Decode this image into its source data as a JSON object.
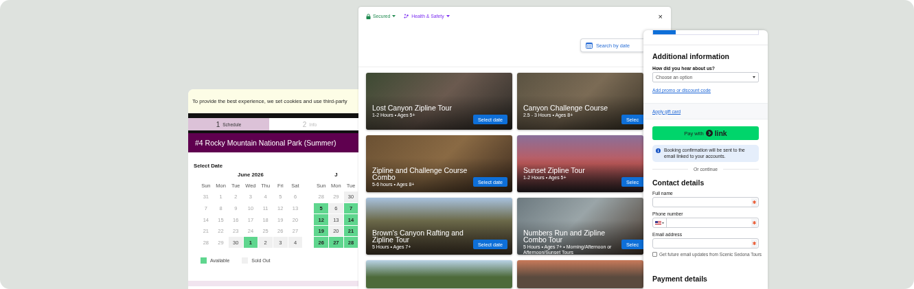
{
  "left_window": {
    "cookie_banner": "To provide the best experience, we set cookies and use third-party",
    "steps": [
      {
        "number": "1",
        "label": "Schedule",
        "selected": true
      },
      {
        "number": "2",
        "label": "Info",
        "selected": false
      }
    ],
    "title": "#4 Rocky Mountain National Park (Summer)",
    "select_date_label": "Select Date",
    "months": [
      {
        "title": "June 2026",
        "weekdays": [
          "Sun",
          "Mon",
          "Tue",
          "Wed",
          "Thu",
          "Fri",
          "Sat"
        ],
        "weeks": [
          [
            {
              "day": "31",
              "kind": "outside"
            },
            {
              "day": "1",
              "kind": "outside"
            },
            {
              "day": "2",
              "kind": "outside"
            },
            {
              "day": "3",
              "kind": "outside"
            },
            {
              "day": "4",
              "kind": "outside"
            },
            {
              "day": "5",
              "kind": "outside"
            },
            {
              "day": "6",
              "kind": "outside"
            }
          ],
          [
            {
              "day": "7",
              "kind": "outside"
            },
            {
              "day": "8",
              "kind": "outside"
            },
            {
              "day": "9",
              "kind": "outside"
            },
            {
              "day": "10",
              "kind": "outside"
            },
            {
              "day": "11",
              "kind": "outside"
            },
            {
              "day": "12",
              "kind": "outside"
            },
            {
              "day": "13",
              "kind": "outside"
            }
          ],
          [
            {
              "day": "14",
              "kind": "outside"
            },
            {
              "day": "15",
              "kind": "outside"
            },
            {
              "day": "16",
              "kind": "outside"
            },
            {
              "day": "17",
              "kind": "outside"
            },
            {
              "day": "18",
              "kind": "outside"
            },
            {
              "day": "19",
              "kind": "outside"
            },
            {
              "day": "20",
              "kind": "outside"
            }
          ],
          [
            {
              "day": "21",
              "kind": "outside"
            },
            {
              "day": "22",
              "kind": "outside"
            },
            {
              "day": "23",
              "kind": "outside"
            },
            {
              "day": "24",
              "kind": "outside"
            },
            {
              "day": "25",
              "kind": "outside"
            },
            {
              "day": "26",
              "kind": "outside"
            },
            {
              "day": "27",
              "kind": "outside"
            }
          ],
          [
            {
              "day": "28",
              "kind": "outside"
            },
            {
              "day": "29",
              "kind": "outside"
            },
            {
              "day": "30",
              "kind": "sold_out"
            },
            {
              "day": "1",
              "kind": "available"
            },
            {
              "day": "2",
              "kind": "sold_out"
            },
            {
              "day": "3",
              "kind": "sold_out"
            },
            {
              "day": "4",
              "kind": "sold_out"
            }
          ]
        ]
      },
      {
        "title": "J",
        "weekdays": [
          "Sun",
          "Mon",
          "Tue"
        ],
        "weeks": [
          [
            {
              "day": "28",
              "kind": "outside"
            },
            {
              "day": "29",
              "kind": "outside"
            },
            {
              "day": "30",
              "kind": "sold_out"
            }
          ],
          [
            {
              "day": "5",
              "kind": "available"
            },
            {
              "day": "6",
              "kind": "sold_out"
            },
            {
              "day": "7",
              "kind": "available"
            }
          ],
          [
            {
              "day": "12",
              "kind": "available"
            },
            {
              "day": "13",
              "kind": "sold_out"
            },
            {
              "day": "14",
              "kind": "available"
            }
          ],
          [
            {
              "day": "19",
              "kind": "available"
            },
            {
              "day": "20",
              "kind": "sold_out"
            },
            {
              "day": "21",
              "kind": "available"
            }
          ],
          [
            {
              "day": "26",
              "kind": "available"
            },
            {
              "day": "27",
              "kind": "available"
            },
            {
              "day": "28",
              "kind": "available"
            }
          ]
        ]
      }
    ],
    "legend": [
      {
        "label": "Available",
        "kind": "available"
      },
      {
        "label": "Sold Out",
        "kind": "sold_out"
      }
    ]
  },
  "booking_window": {
    "security": "Secured",
    "health": "Health & Safety",
    "close": "×",
    "search_button": "Search by date",
    "tours": [
      {
        "title": "Lost Canyon Zipline Tour",
        "meta": "1-2 Hours • Ages 5+",
        "button": "Select date"
      },
      {
        "title": "Canyon Challenge Course",
        "meta": "2.5 - 3 Hours • Ages 8+",
        "button": "Selec"
      },
      {
        "title": "Zipline and Challenge Course Combo",
        "meta": "5-6 hours • Ages 8+",
        "button": "Select date"
      },
      {
        "title": "Sunset Zipline Tour",
        "meta": "1-2 Hours • Ages 5+",
        "button": "Selec"
      },
      {
        "title": "Brown's Canyon Rafting and Zipline Tour",
        "meta": "5 Hours • Ages 7+",
        "button": "Select date"
      },
      {
        "title": "Numbers Run and Zipline Combo Tour",
        "meta": "5 Hours • Ages 7+ • Morning/Afternoon or Afternoon/Sunset Tours",
        "button": "Selec"
      }
    ]
  },
  "checkout_panel": {
    "additional_heading": "Additional information",
    "referral_label": "How did you hear about us?",
    "referral_placeholder": "Choose an option",
    "promo_link": "Add promo or discount code",
    "gift_card_link": "Apply gift card",
    "pay_button": {
      "label": "Pay with",
      "brand": "link"
    },
    "info_message": "Booking confirmation will be sent to the email linked to your accounts.",
    "divider_text": "Or continue",
    "contact_heading": "Contact details",
    "fields": [
      {
        "label": "Full name",
        "kind": "text",
        "required": true
      },
      {
        "label": "Phone number",
        "kind": "phone",
        "required": true
      },
      {
        "label": "Email address",
        "kind": "text",
        "required": true
      }
    ],
    "updates_checkbox": {
      "label": "Get future email updates from Scenic Sedona Tours",
      "checked": false
    },
    "payment_heading": "Payment details"
  }
}
